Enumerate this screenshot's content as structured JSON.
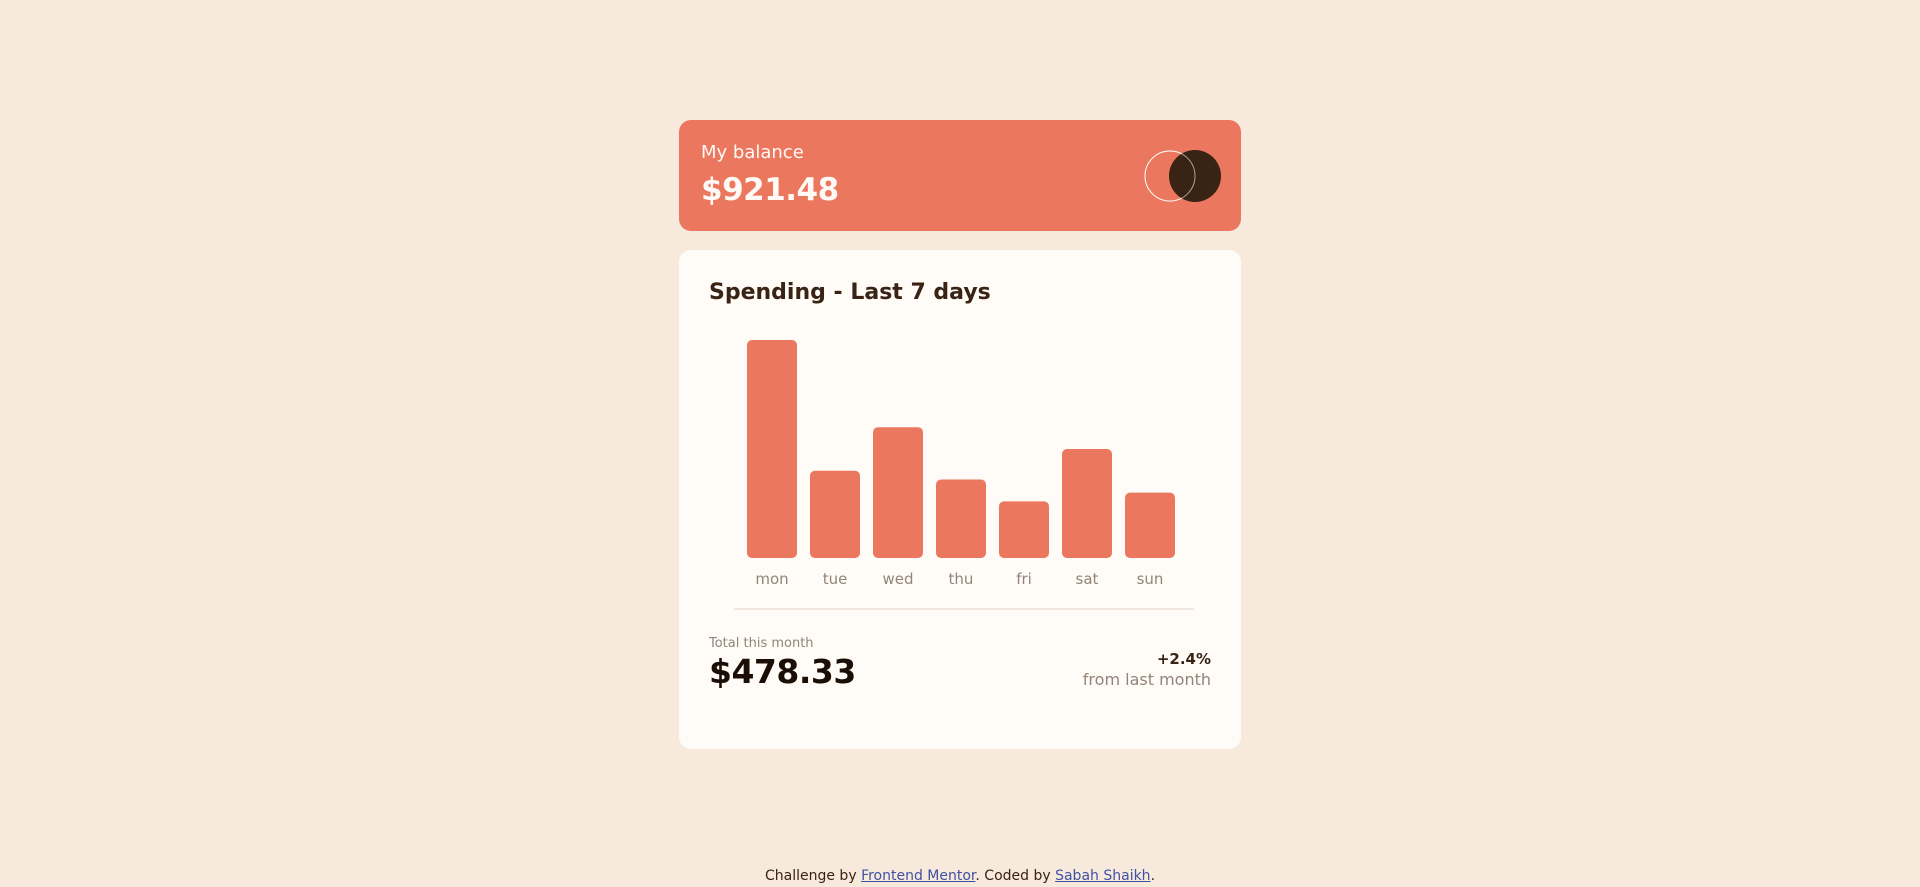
{
  "balance": {
    "label": "My balance",
    "amount": "$921.48"
  },
  "spending": {
    "title": "Spending - Last 7 days",
    "total_label": "Total this month",
    "total_amount": "$478.33",
    "change_value": "+2.4%",
    "change_caption": "from last month"
  },
  "chart_data": {
    "type": "bar",
    "title": "Spending - Last 7 days",
    "categories": [
      "mon",
      "tue",
      "wed",
      "thu",
      "fri",
      "sat",
      "sun"
    ],
    "values": [
      50,
      20,
      30,
      18,
      13,
      25,
      15
    ],
    "ylim": [
      0,
      50
    ],
    "grid": false,
    "legend": "none",
    "bar_color": "#ec775f"
  },
  "footer": {
    "challenge_by": "Challenge by",
    "frontend_mentor_link": "Frontend Mentor",
    "coded_by": ". Coded by",
    "author_link": "Sabah Shaikh",
    "end": "."
  },
  "colors": {
    "page_background": "#f8e9dd",
    "balance_card": "#ec775f",
    "spending_card": "#fffbf6",
    "dark_text": "#382314",
    "muted_text": "#92857a",
    "logo_dark": "#382314"
  }
}
